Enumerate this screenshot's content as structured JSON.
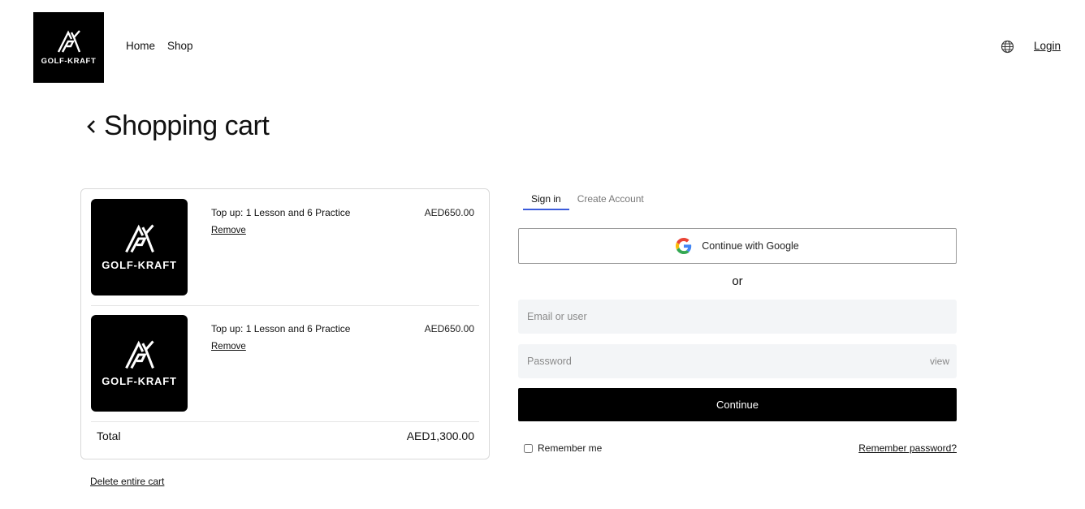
{
  "header": {
    "logo_text": "GOLF-KRAFT",
    "nav": [
      {
        "label": "Home"
      },
      {
        "label": "Shop"
      }
    ],
    "globe_icon": "globe-icon",
    "login_label": "Login"
  },
  "page": {
    "title": "Shopping cart",
    "back_icon": "chevron-left-icon"
  },
  "cart": {
    "items": [
      {
        "brand": "GOLF-KRAFT",
        "name": "Top up: 1 Lesson and 6 Practice",
        "remove_label": "Remove",
        "price": "AED650.00"
      },
      {
        "brand": "GOLF-KRAFT",
        "name": "Top up: 1 Lesson and 6 Practice",
        "remove_label": "Remove",
        "price": "AED650.00"
      }
    ],
    "total_label": "Total",
    "total_value": "AED1,300.00",
    "delete_label": "Delete entire cart"
  },
  "auth": {
    "tabs": [
      {
        "label": "Sign in",
        "active": true
      },
      {
        "label": "Create Account",
        "active": false
      }
    ],
    "google_label": "Continue with Google",
    "google_icon": "google-icon",
    "or_label": "or",
    "email_placeholder": "Email or user",
    "password_placeholder": "Password",
    "view_label": "view",
    "continue_label": "Continue",
    "remember_label": "Remember me",
    "remember_checked": false,
    "remember_password_label": "Remember password?"
  },
  "colors": {
    "brand_black": "#000000",
    "tab_underline": "#3b5bdb",
    "field_bg": "#f3f5f7"
  }
}
